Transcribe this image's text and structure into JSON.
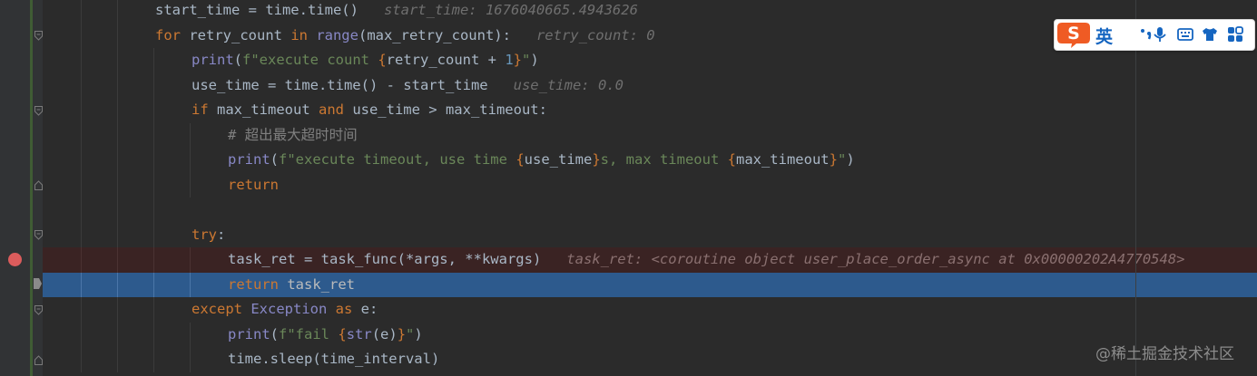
{
  "editor": {
    "lines": [
      {
        "id": "l1",
        "indent": 3,
        "code": [
          [
            "plain",
            "start_time = time.time()"
          ]
        ],
        "hint": "start_time: 1676040665.4943626"
      },
      {
        "id": "l2",
        "indent": 3,
        "code": [
          [
            "kw",
            "for "
          ],
          [
            "plain",
            "retry_count "
          ],
          [
            "kw",
            "in "
          ],
          [
            "bi",
            "range"
          ],
          [
            "plain",
            "(max_retry_count):"
          ]
        ],
        "hint": "retry_count: 0"
      },
      {
        "id": "l3",
        "indent": 4,
        "code": [
          [
            "bi",
            "print"
          ],
          [
            "plain",
            "("
          ],
          [
            "str",
            "f\"execute count "
          ],
          [
            "kw",
            "{"
          ],
          [
            "plain",
            "retry_count + "
          ],
          [
            "num",
            "1"
          ],
          [
            "kw",
            "}"
          ],
          [
            "str",
            "\""
          ],
          [
            "plain",
            ")"
          ]
        ],
        "hint": ""
      },
      {
        "id": "l4",
        "indent": 4,
        "code": [
          [
            "plain",
            "use_time = time.time() - start_time"
          ]
        ],
        "hint": "use_time: 0.0"
      },
      {
        "id": "l5",
        "indent": 4,
        "code": [
          [
            "kw",
            "if "
          ],
          [
            "plain",
            "max_timeout "
          ],
          [
            "kw",
            "and "
          ],
          [
            "plain",
            "use_time > max_timeout:"
          ]
        ],
        "hint": ""
      },
      {
        "id": "l6",
        "indent": 5,
        "code": [
          [
            "cmt",
            "# 超出最大超时时间"
          ]
        ],
        "hint": ""
      },
      {
        "id": "l7",
        "indent": 5,
        "code": [
          [
            "bi",
            "print"
          ],
          [
            "plain",
            "("
          ],
          [
            "str",
            "f\"execute timeout, use time "
          ],
          [
            "kw",
            "{"
          ],
          [
            "plain",
            "use_time"
          ],
          [
            "kw",
            "}"
          ],
          [
            "str",
            "s, max timeout "
          ],
          [
            "kw",
            "{"
          ],
          [
            "plain",
            "max_timeout"
          ],
          [
            "kw",
            "}"
          ],
          [
            "str",
            "\""
          ],
          [
            "plain",
            ")"
          ]
        ],
        "hint": ""
      },
      {
        "id": "l8",
        "indent": 5,
        "code": [
          [
            "kw",
            "return"
          ]
        ],
        "hint": ""
      },
      {
        "id": "l9",
        "indent": 4,
        "code": [],
        "hint": ""
      },
      {
        "id": "l10",
        "indent": 4,
        "code": [
          [
            "kw",
            "try"
          ],
          [
            "plain",
            ":"
          ]
        ],
        "hint": ""
      },
      {
        "id": "l11",
        "indent": 5,
        "code": [
          [
            "plain",
            "task_ret = task_func(*args, **kwargs)"
          ]
        ],
        "hint": "task_ret: <coroutine object user_place_order_async at 0x00000202A4770548>",
        "state": "bp"
      },
      {
        "id": "l12",
        "indent": 5,
        "code": [
          [
            "kw",
            "return "
          ],
          [
            "plain",
            "task_ret"
          ]
        ],
        "hint": "",
        "state": "cur"
      },
      {
        "id": "l13",
        "indent": 4,
        "code": [
          [
            "kw",
            "except "
          ],
          [
            "bi",
            "Exception "
          ],
          [
            "kw",
            "as "
          ],
          [
            "plain",
            "e:"
          ]
        ],
        "hint": ""
      },
      {
        "id": "l14",
        "indent": 5,
        "code": [
          [
            "bi",
            "print"
          ],
          [
            "plain",
            "("
          ],
          [
            "str",
            "f\"fail "
          ],
          [
            "kw",
            "{"
          ],
          [
            "bi",
            "str"
          ],
          [
            "plain",
            "(e)"
          ],
          [
            "kw",
            "}"
          ],
          [
            "str",
            "\""
          ],
          [
            "plain",
            ")"
          ]
        ],
        "hint": ""
      },
      {
        "id": "l15",
        "indent": 5,
        "code": [
          [
            "plain",
            "time.sleep(time_interval)"
          ]
        ],
        "hint": ""
      }
    ]
  },
  "ime_toolbar": {
    "lang_label": "英",
    "icons": [
      "sogou-logo-icon",
      "punctuation-icon",
      "microphone-icon",
      "keyboard-icon",
      "skin-shirt-icon",
      "toolbox-grid-icon"
    ]
  },
  "watermark": {
    "text": "@稀土掘金技术社区"
  },
  "colors": {
    "background": "#2b2b2b",
    "current_line": "#2d5a8d",
    "breakpoint_line": "#3a2323",
    "breakpoint_dot": "#db5c5c",
    "keyword": "#cc7832",
    "builtin": "#8888c6",
    "string": "#6a8759",
    "number": "#6897bb",
    "ime_accent": "#1565c0",
    "ime_logo": "#ef5b24"
  }
}
